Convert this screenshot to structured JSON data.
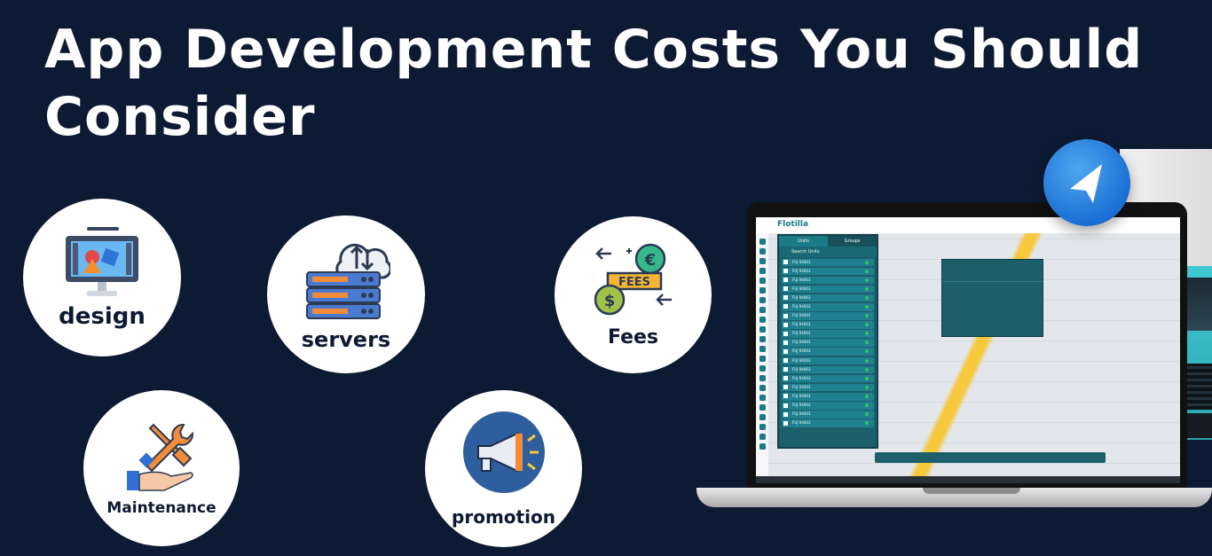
{
  "headline": "App Development Costs You Should Consider",
  "cards": {
    "design": "design",
    "servers": "servers",
    "fees": "Fees",
    "maintenance": "Maintenance",
    "promotion": "promotion"
  },
  "fees_sign_text": "FEES",
  "app": {
    "logo": "Flotilla",
    "tabs": [
      "Units",
      "Groups"
    ],
    "search_placeholder": "Search Units",
    "unit_row_label": "FUJ 94063"
  },
  "colors": {
    "background": "#0d1a33",
    "circle": "#ffffff",
    "label": "#0d1a33",
    "accent_teal": "#1a7a86"
  },
  "icons": [
    "monitor-design-icon",
    "server-cloud-icon",
    "fees-currency-icon",
    "wrench-screwdriver-hand-icon",
    "megaphone-icon",
    "location-arrow-icon"
  ]
}
